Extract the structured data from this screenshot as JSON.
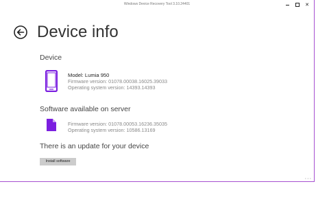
{
  "window": {
    "title": "Windows Device Recovery Tool 3.10.24401",
    "controls": {
      "minimize": "minimize",
      "maximize": "maximize",
      "close": "✕"
    }
  },
  "page": {
    "title": "Device info"
  },
  "device": {
    "heading": "Device",
    "model": "Model: Lumia 950",
    "firmware": "Firmware version: 01078.00038.16025.39033",
    "os": "Operating system version: 14393.14393"
  },
  "server": {
    "heading": "Software available on server",
    "firmware": "Firmware version: 01078.00053.16236.35035",
    "os": "Operating system version: 10586.13169"
  },
  "update": {
    "heading": "There is an update for your device",
    "button_label": "Install software"
  },
  "colors": {
    "accent": "#7b1fe0",
    "border": "#a64fd0",
    "button": "#cccccc"
  },
  "icons": {
    "back": "back-arrow-icon",
    "phone": "phone-icon",
    "file": "file-icon"
  }
}
